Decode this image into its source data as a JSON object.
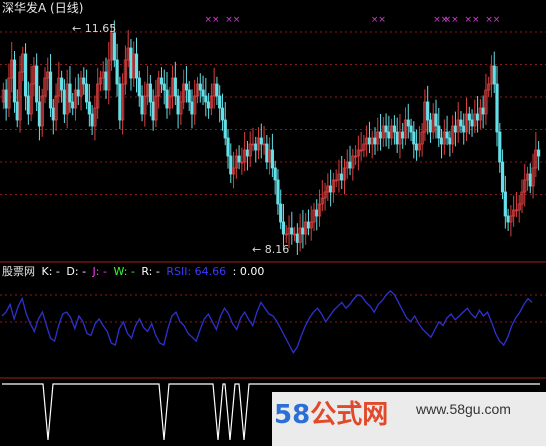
{
  "title": "深华发A (日线)",
  "annotations": {
    "high": "11.65",
    "low": "8.16"
  },
  "indicator_row": {
    "name": "股票网",
    "items": [
      {
        "label": "K: -",
        "color": "#ffffff"
      },
      {
        "label": "D: -",
        "color": "#ffffff"
      },
      {
        "label": "J: -",
        "color": "#ff3bff"
      },
      {
        "label": "W: -",
        "color": "#33ff33"
      },
      {
        "label": "R: -",
        "color": "#ffffff"
      },
      {
        "label": "RSII: 64.66",
        "color": "#3a3aff"
      },
      {
        "label": ": 0.00",
        "color": "#ffffff"
      }
    ]
  },
  "watermark": {
    "logo_58": "58",
    "logo_text": "公式网",
    "url": "www.58gu.com"
  },
  "colors": {
    "up": "#d94040",
    "down": "#66e0e8",
    "rsi": "#3030d0",
    "grid": "#8b1a1a",
    "signal": "#d040d0",
    "bottom_line": "#ffffff"
  },
  "chart_data": [
    {
      "type": "candlestick",
      "title": "深华发A (日线)",
      "ylim": [
        7.9,
        11.9
      ],
      "max_label": 11.65,
      "min_label": 8.16,
      "close": [
        10.7,
        10.4,
        10.9,
        11.2,
        10.5,
        10.2,
        11.0,
        11.3,
        10.6,
        10.3,
        10.8,
        11.1,
        10.5,
        10.1,
        10.6,
        10.9,
        11.0,
        10.4,
        10.2,
        10.6,
        10.9,
        10.7,
        10.3,
        10.8,
        10.5,
        10.4,
        10.7,
        10.6,
        10.9,
        10.8,
        10.5,
        10.3,
        10.1,
        10.4,
        10.8,
        10.9,
        11.0,
        10.7,
        11.2,
        11.65,
        11.2,
        10.8,
        10.2,
        10.8,
        11.2,
        11.4,
        10.9,
        11.3,
        10.9,
        10.6,
        10.3,
        10.6,
        10.8,
        10.5,
        10.2,
        10.6,
        10.9,
        10.8,
        10.7,
        10.4,
        10.6,
        10.9,
        10.6,
        10.3,
        10.5,
        10.8,
        10.7,
        10.5,
        10.3,
        10.6,
        10.8,
        10.7,
        10.6,
        10.5,
        10.4,
        10.6,
        10.8,
        10.6,
        10.4,
        10.2,
        9.9,
        9.6,
        9.3,
        9.4,
        9.6,
        9.5,
        9.5,
        9.7,
        9.6,
        9.8,
        9.8,
        9.7,
        9.9,
        9.8,
        9.8,
        9.5,
        9.7,
        9.4,
        9.2,
        8.8,
        8.5,
        8.3,
        8.3,
        8.4,
        8.3,
        8.3,
        8.16,
        8.4,
        8.3,
        8.5,
        8.4,
        8.5,
        8.7,
        8.6,
        8.8,
        8.9,
        9.0,
        9.1,
        9.0,
        9.2,
        9.2,
        9.3,
        9.2,
        9.4,
        9.5,
        9.4,
        9.6,
        9.6,
        9.7,
        9.7,
        9.8,
        9.9,
        9.8,
        9.9,
        9.8,
        10.0,
        9.9,
        10.1,
        10.0,
        9.9,
        10.1,
        10.0,
        9.8,
        10.0,
        9.9,
        10.2,
        10.1,
        10.0,
        9.8,
        9.7,
        9.8,
        10.0,
        10.5,
        10.2,
        10.0,
        10.3,
        10.1,
        9.9,
        9.8,
        10.0,
        9.9,
        9.8,
        10.1,
        10.0,
        10.2,
        10.1,
        10.0,
        10.3,
        10.2,
        10.1,
        10.3,
        10.2,
        10.4,
        10.3,
        10.7,
        10.8,
        11.1,
        10.8,
        10.0,
        9.5,
        9.0,
        8.6,
        8.5,
        8.6,
        8.7,
        8.7,
        8.8,
        9.0,
        9.2,
        9.3,
        9.1,
        9.4,
        9.7,
        9.6
      ]
    },
    {
      "type": "line",
      "series": [
        {
          "name": "RSII",
          "last": 64.66
        }
      ],
      "ylim": [
        0,
        100
      ],
      "values": [
        58,
        62,
        70,
        55,
        68,
        76,
        60,
        50,
        42,
        55,
        62,
        48,
        35,
        32,
        48,
        60,
        62,
        56,
        45,
        58,
        52,
        40,
        38,
        50,
        55,
        48,
        42,
        30,
        28,
        45,
        52,
        40,
        35,
        48,
        55,
        46,
        42,
        50,
        38,
        30,
        28,
        45,
        58,
        62,
        52,
        48,
        40,
        36,
        32,
        44,
        55,
        60,
        52,
        44,
        58,
        66,
        60,
        50,
        44,
        56,
        62,
        54,
        48,
        62,
        72,
        66,
        60,
        58,
        52,
        44,
        36,
        28,
        20,
        26,
        38,
        48,
        56,
        62,
        66,
        60,
        52,
        58,
        64,
        68,
        72,
        66,
        70,
        76,
        80,
        78,
        72,
        68,
        62,
        70,
        74,
        80,
        84,
        80,
        72,
        64,
        56,
        52,
        58,
        50,
        44,
        40,
        36,
        44,
        52,
        48,
        56,
        60,
        54,
        58,
        62,
        66,
        60,
        56,
        64,
        58,
        62,
        52,
        40,
        32,
        28,
        36,
        48,
        56,
        62,
        70,
        76,
        72
      ],
      "signals_top": [
        14,
        18,
        46,
        58,
        60,
        64,
        68
      ],
      "signals_bottom": [
        14,
        39,
        54,
        58,
        61
      ]
    }
  ]
}
